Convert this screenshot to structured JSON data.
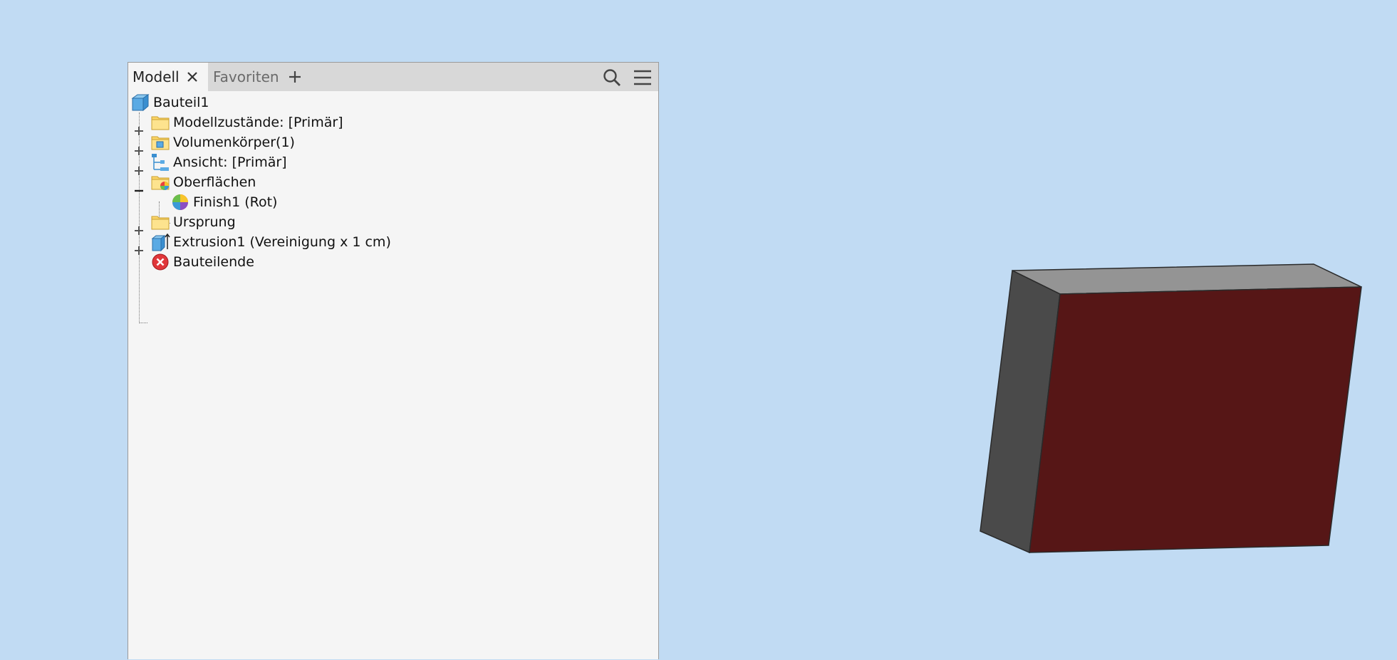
{
  "tabs": {
    "model_label": "Modell",
    "favorites_label": "Favoriten"
  },
  "tree": {
    "root": "Bauteil1",
    "items": [
      {
        "label": "Modellzustände: [Primär]",
        "icon": "folder-icon",
        "expander": "plus"
      },
      {
        "label": "Volumenkörper(1)",
        "icon": "solid-bodies-folder-icon",
        "expander": "plus"
      },
      {
        "label": "Ansicht: [Primär]",
        "icon": "view-rep-icon",
        "expander": "plus"
      },
      {
        "label": "Oberflächen",
        "icon": "appearance-folder-icon",
        "expander": "minus"
      },
      {
        "label": "Finish1 (Rot)",
        "icon": "appearance-ball-icon",
        "expander": "none"
      },
      {
        "label": "Ursprung",
        "icon": "folder-icon",
        "expander": "plus"
      },
      {
        "label": "Extrusion1 (Vereinigung x 1 cm)",
        "icon": "extrusion-icon",
        "expander": "plus"
      },
      {
        "label": "Bauteilende",
        "icon": "end-of-part-icon",
        "expander": "none"
      }
    ]
  },
  "colors": {
    "viewport_bg": "#c1dbf3",
    "box_front": "#561616",
    "box_top": "#949494",
    "box_side": "#4a4a4a"
  }
}
